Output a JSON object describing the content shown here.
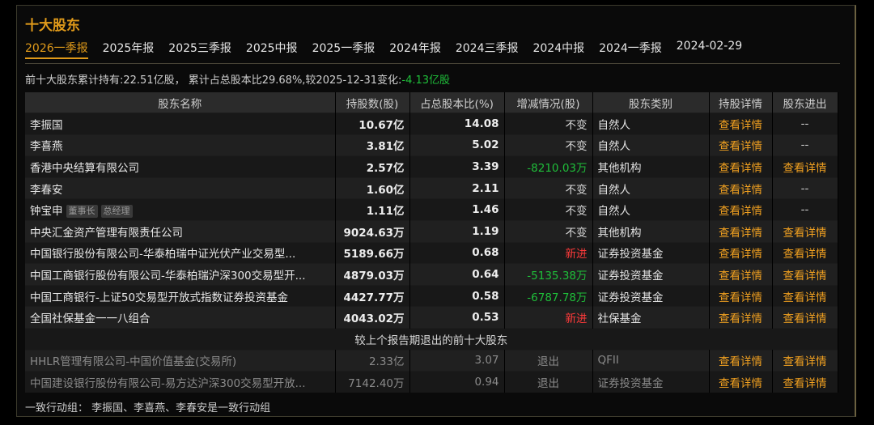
{
  "title": "十大股东",
  "tabs": [
    "2026一季报",
    "2025年报",
    "2025三季报",
    "2025中报",
    "2025一季报",
    "2024年报",
    "2024三季报",
    "2024中报",
    "2024一季报",
    "2024-02-29"
  ],
  "summary": {
    "prefix": "前十大股东累计持有:22.51亿股， 累计占总股本比29.68%,较2025-12-31变化:",
    "change": "-4.13亿股"
  },
  "columns": [
    "股东名称",
    "持股数(股)",
    "占总股本比(%)",
    "增减情况(股)",
    "股东类别",
    "持股详情",
    "股东进出"
  ],
  "rows": [
    {
      "name": "李振国",
      "tags": [],
      "shares": "10.67亿",
      "pct": "14.08",
      "change": "不变",
      "change_color": "neutral",
      "type": "自然人",
      "detail": "查看详情",
      "inout": "--"
    },
    {
      "name": "李喜燕",
      "tags": [],
      "shares": "3.81亿",
      "pct": "5.02",
      "change": "不变",
      "change_color": "neutral",
      "type": "自然人",
      "detail": "查看详情",
      "inout": "--"
    },
    {
      "name": "香港中央结算有限公司",
      "tags": [],
      "shares": "2.57亿",
      "pct": "3.39",
      "change": "-8210.03万",
      "change_color": "green",
      "type": "其他机构",
      "detail": "查看详情",
      "inout": "查看详情"
    },
    {
      "name": "李春安",
      "tags": [],
      "shares": "1.60亿",
      "pct": "2.11",
      "change": "不变",
      "change_color": "neutral",
      "type": "自然人",
      "detail": "查看详情",
      "inout": "--"
    },
    {
      "name": "钟宝申",
      "tags": [
        "董事长",
        "总经理"
      ],
      "shares": "1.11亿",
      "pct": "1.46",
      "change": "不变",
      "change_color": "neutral",
      "type": "自然人",
      "detail": "查看详情",
      "inout": "--"
    },
    {
      "name": "中央汇金资产管理有限责任公司",
      "tags": [],
      "shares": "9024.63万",
      "pct": "1.19",
      "change": "不变",
      "change_color": "neutral",
      "type": "其他机构",
      "detail": "查看详情",
      "inout": "查看详情"
    },
    {
      "name": "中国银行股份有限公司-华泰柏瑞中证光伏产业交易型...",
      "tags": [],
      "shares": "5189.66万",
      "pct": "0.68",
      "change": "新进",
      "change_color": "red",
      "type": "证券投资基金",
      "detail": "查看详情",
      "inout": "查看详情"
    },
    {
      "name": "中国工商银行股份有限公司-华泰柏瑞沪深300交易型开...",
      "tags": [],
      "shares": "4879.03万",
      "pct": "0.64",
      "change": "-5135.38万",
      "change_color": "green",
      "type": "证券投资基金",
      "detail": "查看详情",
      "inout": "查看详情"
    },
    {
      "name": "中国工商银行-上证50交易型开放式指数证券投资基金",
      "tags": [],
      "shares": "4427.77万",
      "pct": "0.58",
      "change": "-6787.78万",
      "change_color": "green",
      "type": "证券投资基金",
      "detail": "查看详情",
      "inout": "查看详情"
    },
    {
      "name": "全国社保基金一一八组合",
      "tags": [],
      "shares": "4043.02万",
      "pct": "0.53",
      "change": "新进",
      "change_color": "red",
      "type": "社保基金",
      "detail": "查看详情",
      "inout": "查看详情"
    }
  ],
  "exited_title": "较上个报告期退出的前十大股东",
  "exited_rows": [
    {
      "name": "HHLR管理有限公司-中国价值基金(交易所)",
      "shares": "2.33亿",
      "pct": "3.07",
      "change": "退出",
      "type": "QFII",
      "detail": "查看详情",
      "inout": "查看详情"
    },
    {
      "name": "中国建设银行股份有限公司-易方达沪深300交易型开放...",
      "shares": "7142.40万",
      "pct": "0.94",
      "change": "退出",
      "type": "证券投资基金",
      "detail": "查看详情",
      "inout": "查看详情"
    }
  ],
  "footer": "一致行动组：  李振国、李喜燕、李春安是一致行动组"
}
